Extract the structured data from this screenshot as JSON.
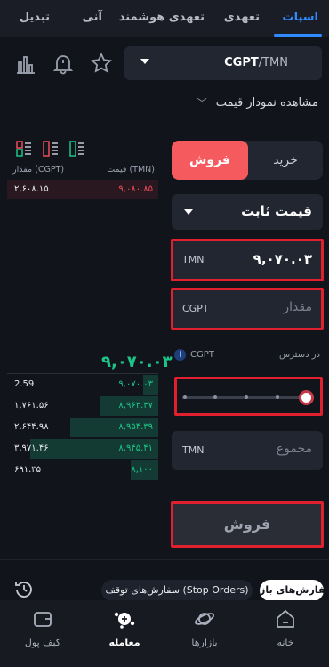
{
  "tabs": [
    {
      "label": "اسپات",
      "active": true
    },
    {
      "label": "تعهدی",
      "active": false
    },
    {
      "label": "تعهدی هوشمند",
      "active": false
    },
    {
      "label": "آنی",
      "active": false
    },
    {
      "label": "تبدیل",
      "active": false
    }
  ],
  "pair": {
    "base": "CGPT",
    "quote": "/TMN"
  },
  "chart_toggle_label": "مشاهده نمودار قیمت",
  "orderbook": {
    "header_price": "قیمت (TMN)",
    "header_amount": "مقدار (CGPT)",
    "asks": [
      {
        "price": "۹,۰۸۰.۸۵",
        "amount": "۲,۶۰۸.۱۵"
      }
    ],
    "last_price": "۹,۰۷۰.۰۳",
    "bids": [
      {
        "price": "۹,۰۷۰.۰۳",
        "amount": "2.59",
        "fill": 0.1
      },
      {
        "price": "۸,۹۶۳.۳۷",
        "amount": "۱,۷۶۱.۵۶",
        "fill": 0.38
      },
      {
        "price": "۸,۹۵۴.۳۹",
        "amount": "۲,۶۴۴.۹۸",
        "fill": 0.58
      },
      {
        "price": "۸,۹۴۵.۴۱",
        "amount": "۳,۹۷۱.۴۶",
        "fill": 0.85
      },
      {
        "price": "۸,۱۰۰",
        "amount": "۶۹۱.۳۵",
        "fill": 0.18
      }
    ]
  },
  "form": {
    "buy_label": "خرید",
    "sell_label": "فروش",
    "order_type": "قیمت ثابت",
    "price_unit": "TMN",
    "price_value": "۹,۰۷۰.۰۳",
    "amount_unit": "CGPT",
    "amount_placeholder": "مقدار",
    "available_label": "در دسترس",
    "available_currency": "CGPT",
    "slider_level": 1.0,
    "total_unit": "TMN",
    "total_placeholder": "مجموع",
    "submit_label": "فروش"
  },
  "orders": {
    "open_label": "سفارش‌های باز",
    "stop_label": "سفارش‌های توقف (Stop Orders)"
  },
  "bottom_nav": [
    {
      "label": "خانه",
      "active": false
    },
    {
      "label": "بازارها",
      "active": false
    },
    {
      "label": "معامله",
      "active": true
    },
    {
      "label": "کیف پول",
      "active": false
    }
  ],
  "colors": {
    "accent": "#2f8bff",
    "buy_green": "#1dc488",
    "sell_red": "#f45a5e",
    "highlight_box": "#e0202f"
  }
}
